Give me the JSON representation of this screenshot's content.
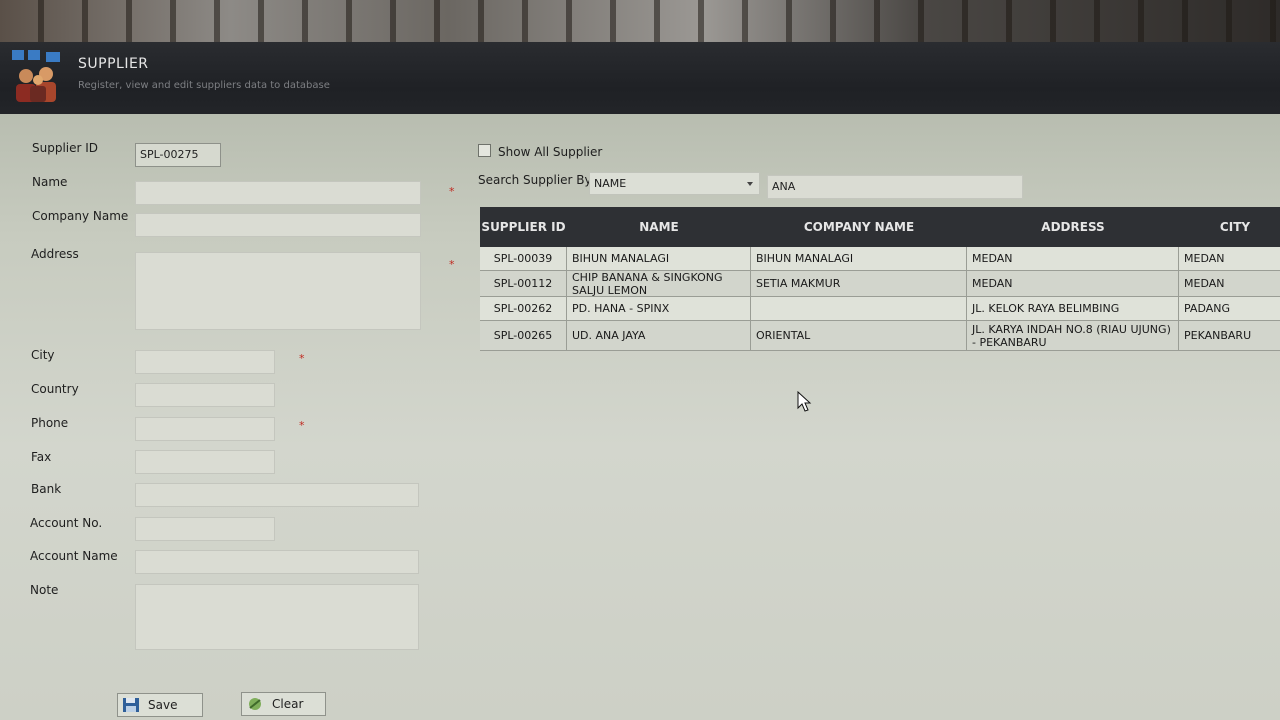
{
  "header": {
    "title": "SUPPLIER",
    "subtitle": "Register, view and edit suppliers data to database"
  },
  "form": {
    "supplier_id_label": "Supplier ID",
    "supplier_id_value": "SPL-00275",
    "name_label": "Name",
    "name_value": "",
    "company_name_label": "Company Name",
    "company_name_value": "",
    "address_label": "Address",
    "address_value": "",
    "city_label": "City",
    "city_value": "",
    "country_label": "Country",
    "country_value": "",
    "phone_label": "Phone",
    "phone_value": "",
    "fax_label": "Fax",
    "fax_value": "",
    "bank_label": "Bank",
    "bank_value": "",
    "account_no_label": "Account No.",
    "account_no_value": "",
    "account_name_label": "Account Name",
    "account_name_value": "",
    "note_label": "Note",
    "note_value": "",
    "required_mark": "*"
  },
  "buttons": {
    "save": "Save",
    "clear": "Clear"
  },
  "search": {
    "show_all_label": "Show All Supplier",
    "show_all_checked": false,
    "search_by_label": "Search Supplier By",
    "search_by_value": "NAME",
    "search_text": "ANA"
  },
  "grid": {
    "columns": [
      "SUPPLIER ID",
      "NAME",
      "COMPANY NAME",
      "ADDRESS",
      "CITY"
    ],
    "rows": [
      {
        "supplier_id": "SPL-00039",
        "name": "BIHUN MANALAGI",
        "company_name": "BIHUN MANALAGI",
        "address": "MEDAN",
        "city": "MEDAN"
      },
      {
        "supplier_id": "SPL-00112",
        "name": "CHIP BANANA & SINGKONG SALJU LEMON",
        "company_name": "SETIA MAKMUR",
        "address": "MEDAN",
        "city": "MEDAN"
      },
      {
        "supplier_id": "SPL-00262",
        "name": "PD. HANA - SPINX",
        "company_name": "",
        "address": "JL. KELOK RAYA BELIMBING",
        "city": "PADANG"
      },
      {
        "supplier_id": "SPL-00265",
        "name": "UD. ANA JAYA",
        "company_name": "ORIENTAL",
        "address": "JL. KARYA INDAH NO.8 (RIAU UJUNG) - PEKANBARU",
        "city": "PEKANBARU"
      }
    ]
  },
  "colors": {
    "header_bg": "#222428",
    "panel_bg": "#cdd0c6",
    "grid_header_bg": "#2e3034",
    "required": "#c0281f"
  }
}
